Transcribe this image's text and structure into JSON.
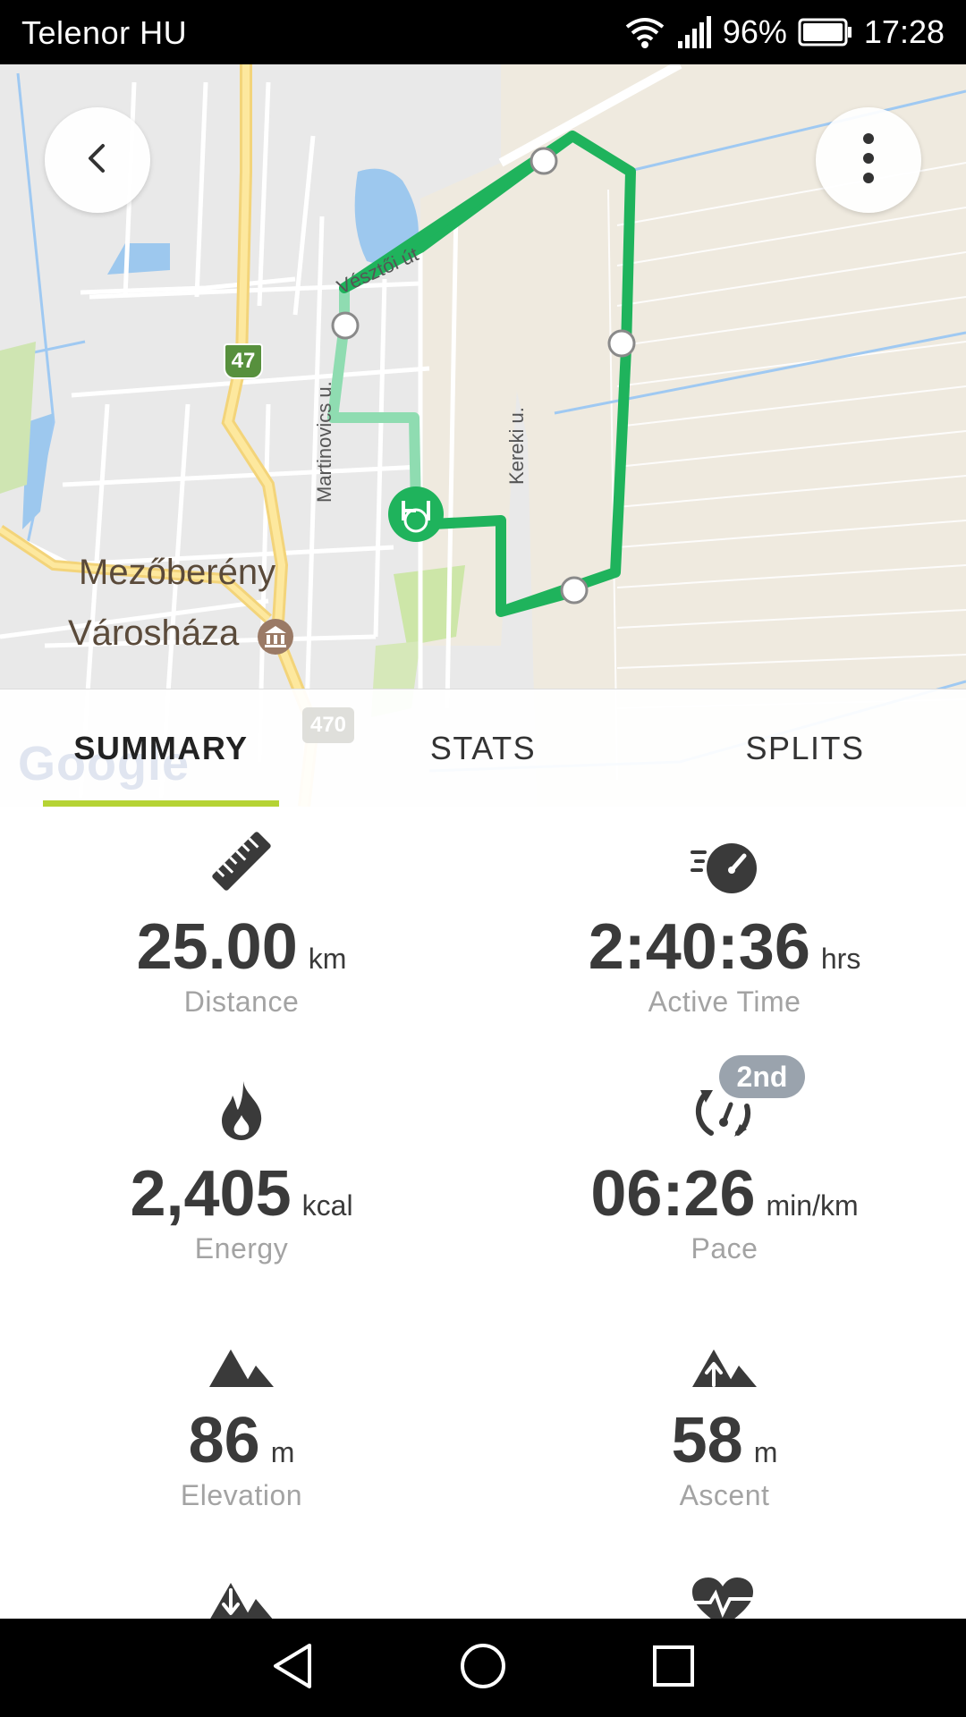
{
  "status_bar": {
    "carrier": "Telenor HU",
    "battery_percent": "96%",
    "time": "17:28",
    "icons": [
      "wifi-icon",
      "signal-icon",
      "battery-icon"
    ]
  },
  "map": {
    "town_label": "Mezőberény",
    "townhall_label": "Városháza",
    "road_47": "47",
    "road_470": "470",
    "street_veszto": "Vésztői út",
    "street_martinovics": "Martinovics u.",
    "street_kereki": "Kereki u.",
    "attribution": "Google",
    "route_color": "#1fb35c",
    "icons": [
      "back-icon",
      "more-vert-icon",
      "start-marker-icon",
      "townhall-icon"
    ]
  },
  "tabs": [
    {
      "label": "SUMMARY",
      "active": true
    },
    {
      "label": "STATS",
      "active": false
    },
    {
      "label": "SPLITS",
      "active": false
    }
  ],
  "tab_indicator_color": "#b5d334",
  "stats": [
    {
      "icon": "ruler-icon",
      "value": "25.00",
      "unit": "km",
      "label": "Distance"
    },
    {
      "icon": "speedometer-icon",
      "value": "2:40:36",
      "unit": "hrs",
      "label": "Active Time"
    },
    {
      "icon": "flame-icon",
      "value": "2,405",
      "unit": "kcal",
      "label": "Energy"
    },
    {
      "icon": "pace-icon",
      "value": "06:26",
      "unit": "min/km",
      "label": "Pace",
      "badge": "2nd"
    },
    {
      "icon": "mountain-icon",
      "value": "86",
      "unit": "m",
      "label": "Elevation"
    },
    {
      "icon": "ascent-icon",
      "value": "58",
      "unit": "m",
      "label": "Ascent"
    }
  ],
  "nav_bar": {
    "icons": [
      "nav-back-icon",
      "nav-home-icon",
      "nav-recents-icon"
    ]
  }
}
